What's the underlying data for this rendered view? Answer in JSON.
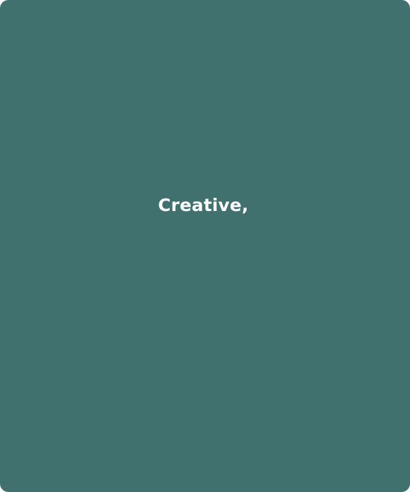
{
  "card": {
    "headline": "Creative,",
    "background_color": "#41716f",
    "text_color": "#ffffff"
  }
}
